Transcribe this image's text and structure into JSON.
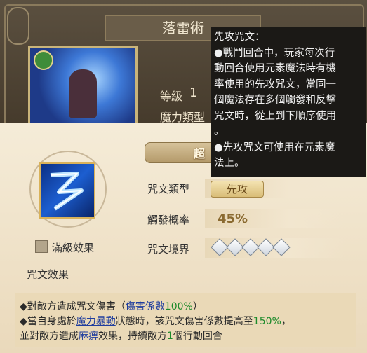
{
  "title": "落雷術",
  "top": {
    "level_label": "等級",
    "level_value": "1",
    "type_label": "魔力類型"
  },
  "rarity_text": "超",
  "enhance_label": "滿級效果",
  "effect_section_label": "咒文效果",
  "rows": {
    "type_label": "咒文類型",
    "type_value": "先攻",
    "prob_label": "觸發概率",
    "prob_value": "45%",
    "realm_label": "咒文境界",
    "realm_level": 5
  },
  "desc": {
    "line1_a": "◆對敵方造成咒文傷害（",
    "line1_b": "傷害係數",
    "line1_c": "100%",
    "line1_d": "）",
    "line2_a": "◆當自身處於",
    "line2_b": "魔力暴動",
    "line2_c": "狀態時，該咒文傷害係數提高至",
    "line2_d": "150%",
    "line2_e": "，",
    "line3_a": "並對敵方造成",
    "line3_b": "麻痹",
    "line3_c": "效果，持續敵方",
    "line3_d": "1",
    "line3_e": "個行動回合"
  },
  "tooltip": {
    "lines": [
      "先攻咒文：",
      "●戰鬥回合中，玩家每次行",
      "動回合使用元素魔法時有機",
      "率使用的先攻咒文，當同一",
      "個魔法存在多個觸發和反擊",
      "咒文時，從上到下順序使用",
      "。",
      "●先攻咒文可使用在元素魔",
      "法上。"
    ]
  },
  "icons": {
    "spell": "lightning-spell-icon",
    "gem": "green-gem-icon",
    "crystal": "crystal-icon"
  },
  "colors": {
    "accent_blue": "#1f3d9e",
    "accent_green": "#1c8a2a",
    "gold": "#8a6a30"
  }
}
